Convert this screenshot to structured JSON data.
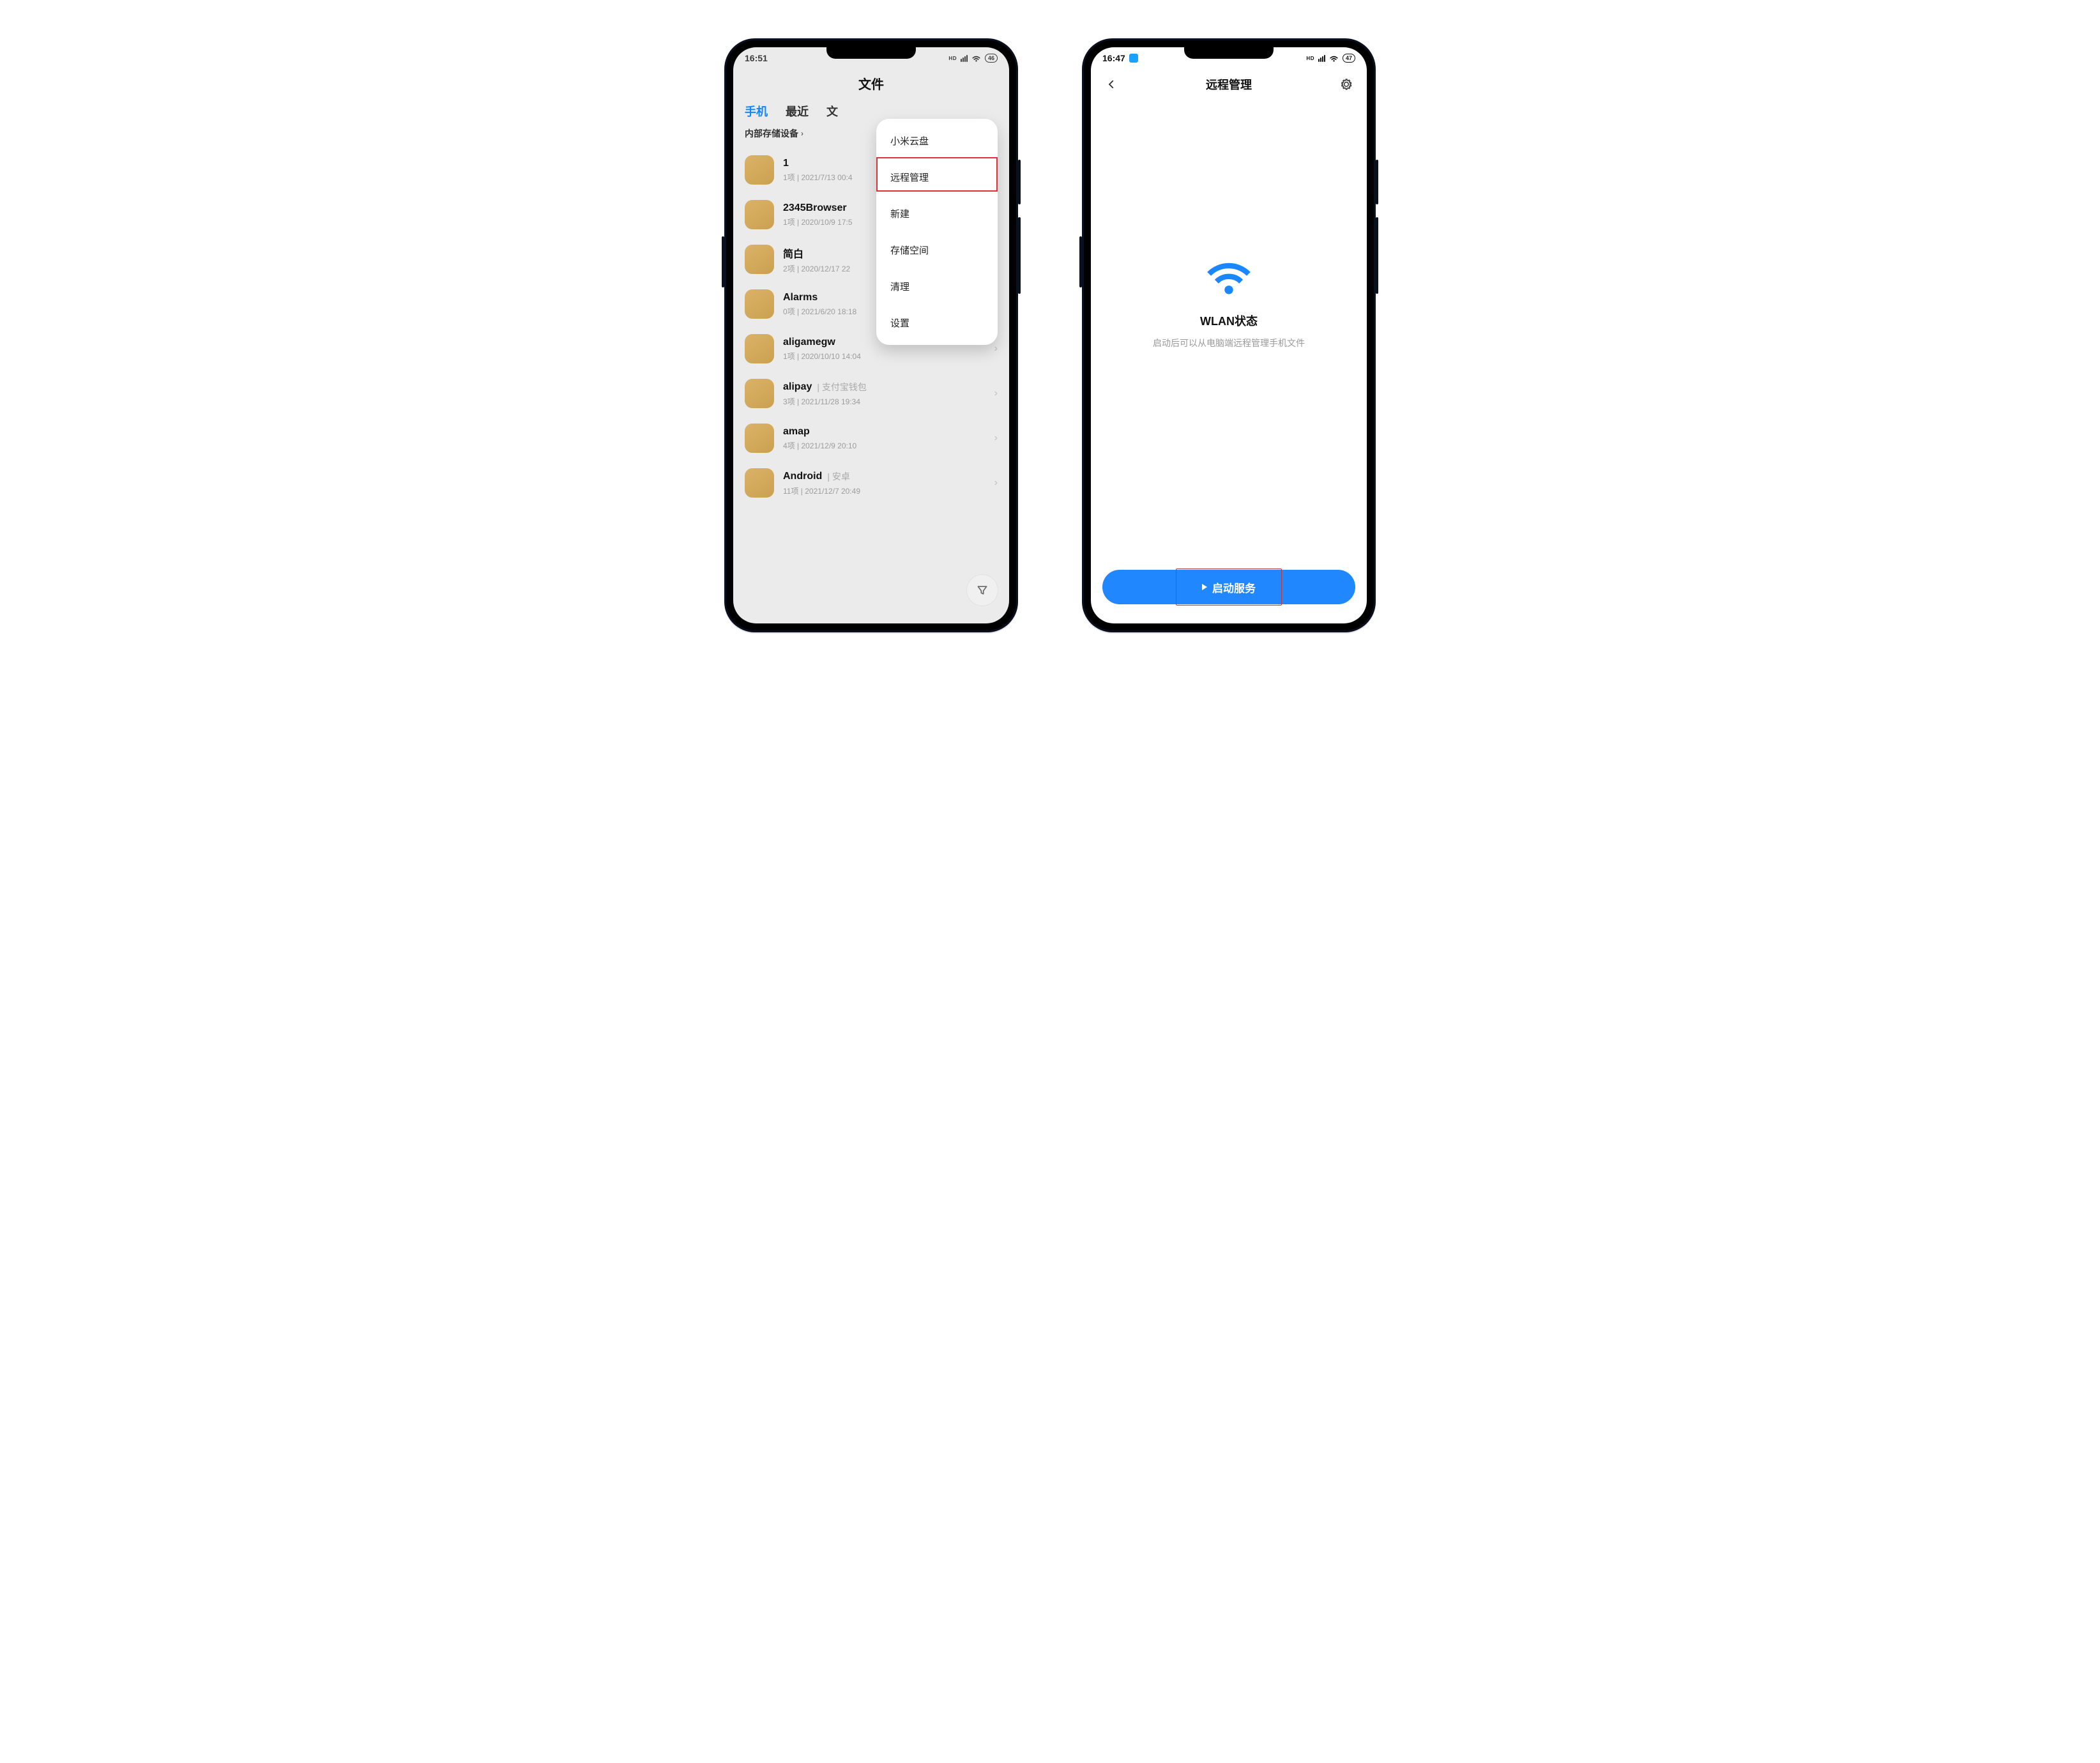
{
  "phone1": {
    "status": {
      "time": "16:51",
      "hd": "HD",
      "battery": "46"
    },
    "app_title_partial": "文件",
    "tabs": [
      "手机",
      "最近",
      "文"
    ],
    "breadcrumb": "内部存储设备",
    "menu": [
      "小米云盘",
      "远程管理",
      "新建",
      "存储空间",
      "清理",
      "设置"
    ],
    "files": [
      {
        "name": "1",
        "alias": "",
        "meta": "1项  |  2021/7/13 00:4"
      },
      {
        "name": "2345Browser",
        "alias": "",
        "meta": "1项  |  2020/10/9 17:5"
      },
      {
        "name": "简白",
        "alias": "",
        "meta": "2项  |  2020/12/17 22"
      },
      {
        "name": "Alarms",
        "alias": "",
        "meta": "0项  |  2021/6/20 18:18"
      },
      {
        "name": "aligamegw",
        "alias": "",
        "meta": "1项  |  2020/10/10 14:04"
      },
      {
        "name": "alipay",
        "alias": "支付宝钱包",
        "meta": "3项  |  2021/11/28 19:34"
      },
      {
        "name": "amap",
        "alias": "",
        "meta": "4项  |  2021/12/9 20:10"
      },
      {
        "name": "Android",
        "alias": "安卓",
        "meta": "11项  |  2021/12/7 20:49"
      }
    ]
  },
  "phone2": {
    "status": {
      "time": "16:47",
      "hd": "HD",
      "battery": "47"
    },
    "title": "远程管理",
    "wlan_title": "WLAN状态",
    "wlan_sub": "启动后可以从电脑端远程管理手机文件",
    "cta": "启动服务"
  }
}
